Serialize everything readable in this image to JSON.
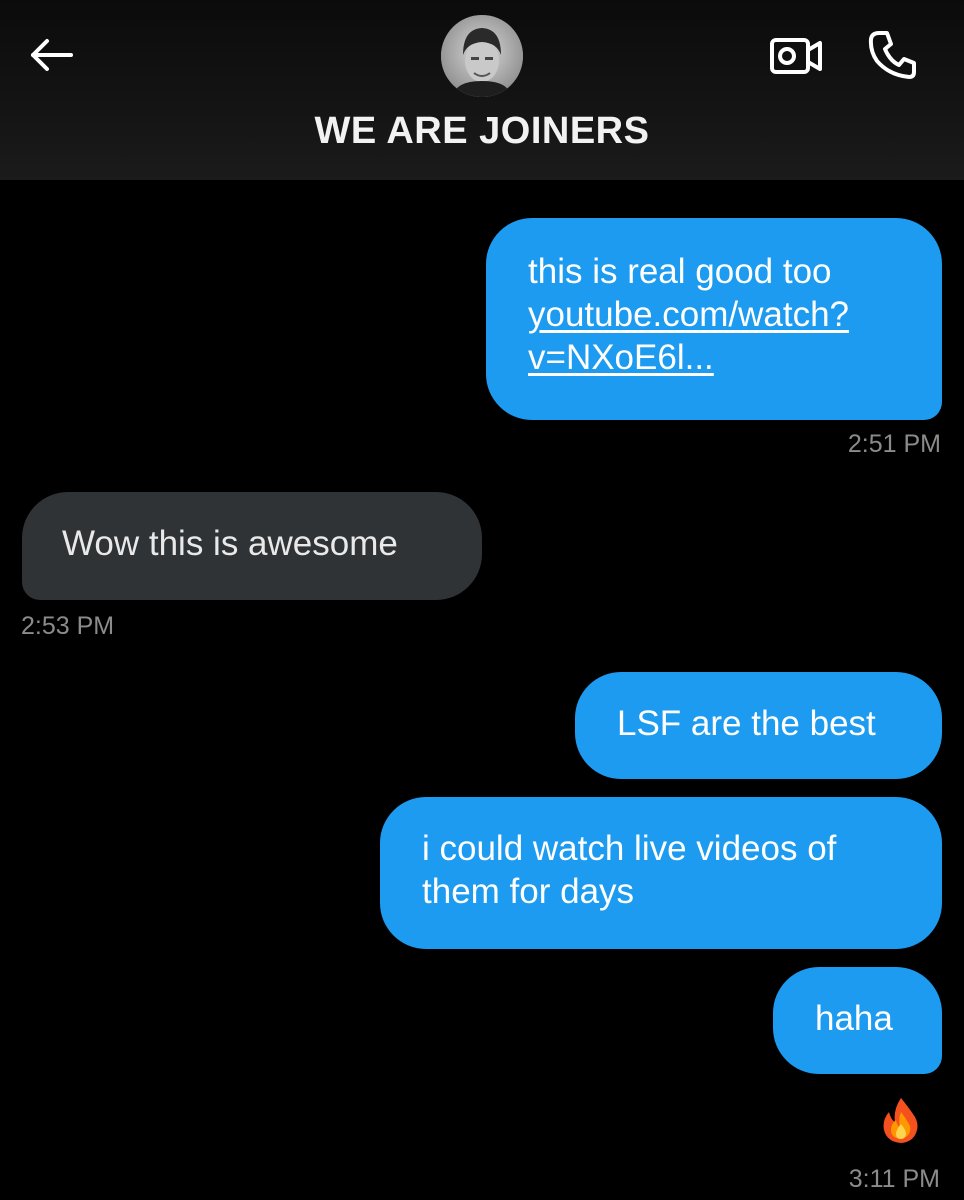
{
  "header": {
    "title": "WE ARE JOINERS",
    "back_icon": "arrow-left-icon",
    "video_icon": "video-camera-icon",
    "phone_icon": "phone-icon",
    "avatar": "contact-avatar"
  },
  "messages": [
    {
      "direction": "outgoing",
      "text": "this is real good too",
      "link_line1": "youtube.com/watch?",
      "link_line2": "v=NXoE6l...",
      "time": "2:51 PM"
    },
    {
      "direction": "incoming",
      "text": "Wow this is awesome",
      "time": "2:53 PM"
    },
    {
      "direction": "outgoing",
      "text": "LSF are the best"
    },
    {
      "direction": "outgoing",
      "text_line1": "i could watch live videos of",
      "text_line2": "them for days"
    },
    {
      "direction": "outgoing",
      "text": "haha",
      "reaction": "fire-emoji",
      "time": "3:11 PM"
    }
  ],
  "colors": {
    "outgoing_bubble": "#1d9bf0",
    "incoming_bubble": "#2f3336",
    "background": "#000000",
    "timestamp": "#8b8b8b"
  }
}
